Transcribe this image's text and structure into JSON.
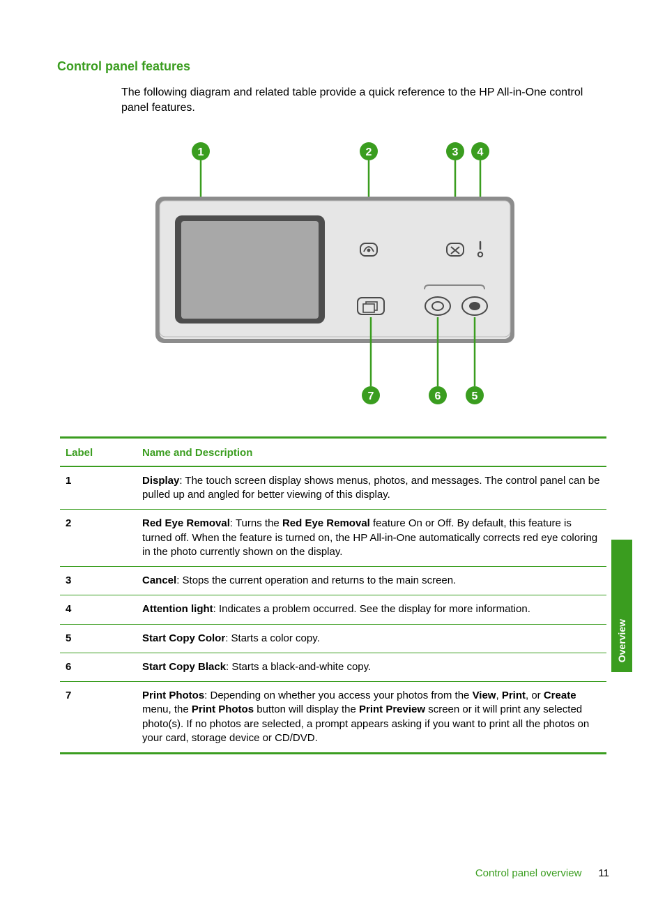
{
  "section_title": "Control panel features",
  "intro": "The following diagram and related table provide a quick reference to the HP All-in-One control panel features.",
  "table": {
    "headers": {
      "label": "Label",
      "desc": "Name and Description"
    },
    "rows": [
      {
        "n": "1",
        "name": "Display",
        "rest": ": The touch screen display shows menus, photos, and messages. The control panel can be pulled up and angled for better viewing of this display."
      },
      {
        "n": "2",
        "name": "Red Eye Removal",
        "rest_pre": ": Turns the ",
        "bold2": "Red Eye Removal",
        "rest_post": " feature On or Off. By default, this feature is turned off. When the feature is turned on, the HP All-in-One automatically corrects red eye coloring in the photo currently shown on the display."
      },
      {
        "n": "3",
        "name": "Cancel",
        "rest": ": Stops the current operation and returns to the main screen."
      },
      {
        "n": "4",
        "name": "Attention light",
        "rest": ": Indicates a problem occurred. See the display for more information."
      },
      {
        "n": "5",
        "name": "Start Copy Color",
        "rest": ": Starts a color copy."
      },
      {
        "n": "6",
        "name": "Start Copy Black",
        "rest": ": Starts a black-and-white copy."
      },
      {
        "n": "7",
        "name": "Print Photos",
        "rest_pre": ": Depending on whether you access your photos from the ",
        "b1": "View",
        "s1": ", ",
        "b2": "Print",
        "s2": ", or ",
        "b3": "Create",
        "rest_mid": " menu, the ",
        "b4": "Print Photos",
        "rest_mid2": " button will display the ",
        "b5": "Print Preview",
        "rest_post": " screen or it will print any selected photo(s). If no photos are selected, a prompt appears asking if you want to print all the photos on your card, storage device or CD/DVD."
      }
    ]
  },
  "callouts": {
    "c1": "1",
    "c2": "2",
    "c3": "3",
    "c4": "4",
    "c5": "5",
    "c6": "6",
    "c7": "7"
  },
  "side_tab": "Overview",
  "footer": {
    "text": "Control panel overview",
    "page": "11"
  }
}
